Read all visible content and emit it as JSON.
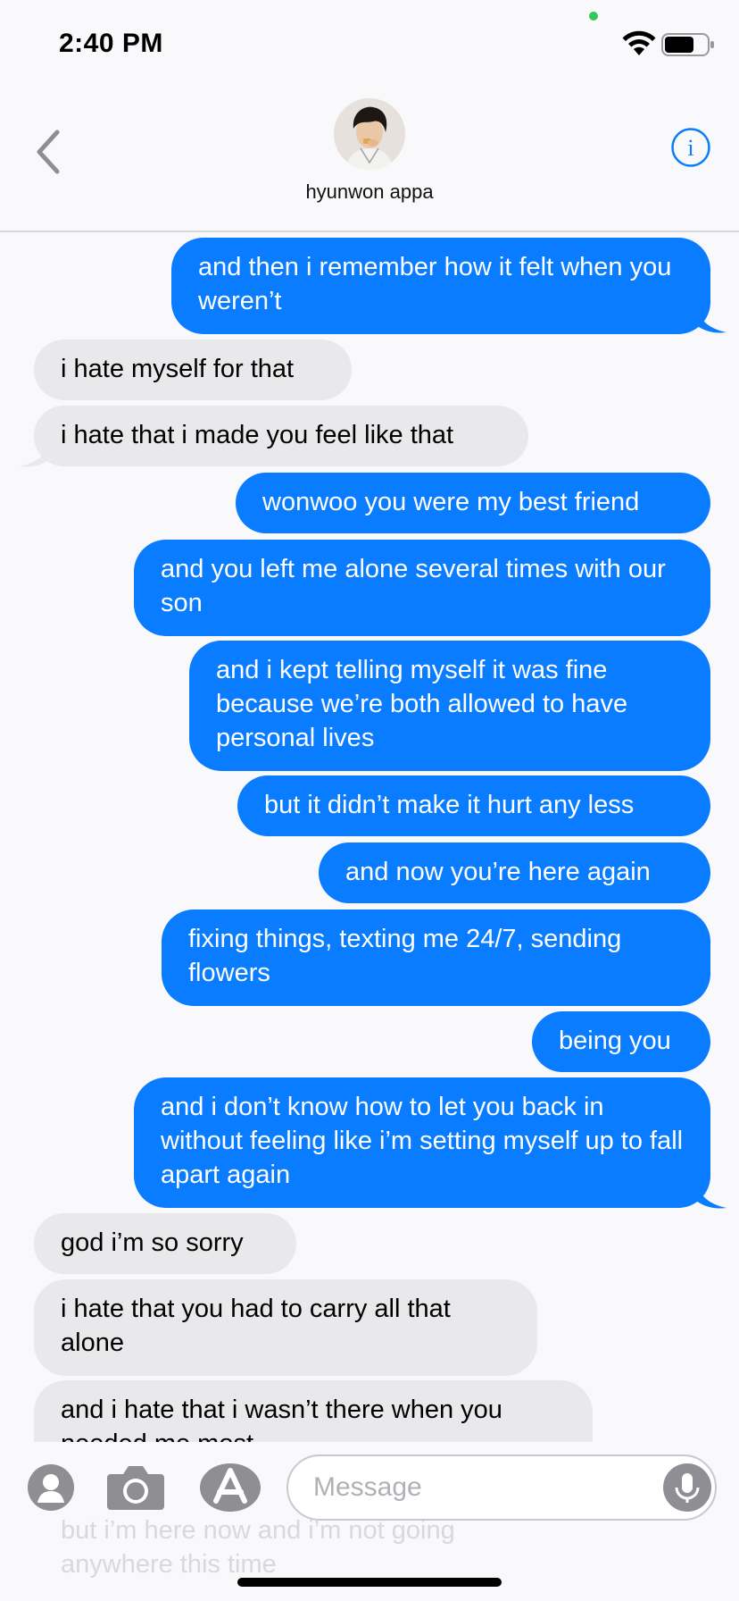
{
  "status_bar": {
    "time": "2:40 PM",
    "icons": [
      "camera-in-use-dot",
      "wifi-icon",
      "battery-icon"
    ]
  },
  "header": {
    "contact_name": "hyunwon appa",
    "back_icon": "chevron-left-icon",
    "info_icon": "info-icon"
  },
  "messages": [
    {
      "direction": "outgoing",
      "text": "and then i remember how it felt when you weren’t"
    },
    {
      "direction": "incoming",
      "text": "i hate myself for that"
    },
    {
      "direction": "incoming",
      "text": "i hate that i made you feel like that"
    },
    {
      "direction": "outgoing",
      "text": "wonwoo you were my best friend"
    },
    {
      "direction": "outgoing",
      "text": "and you left me alone several times with our son"
    },
    {
      "direction": "outgoing",
      "text": "and i kept telling myself it was fine because we’re both allowed to have personal lives"
    },
    {
      "direction": "outgoing",
      "text": "but it didn’t make it hurt any less"
    },
    {
      "direction": "outgoing",
      "text": "and now you’re here again"
    },
    {
      "direction": "outgoing",
      "text": "fixing things, texting me 24/7, sending flowers"
    },
    {
      "direction": "outgoing",
      "text": "being you"
    },
    {
      "direction": "outgoing",
      "text": "and i don’t know how to let you back in without feeling like i’m setting myself up to fall apart again"
    },
    {
      "direction": "incoming",
      "text": "god i’m so sorry"
    },
    {
      "direction": "incoming",
      "text": "i hate that you had to carry all that alone"
    },
    {
      "direction": "incoming",
      "text": "and i hate that i wasn’t there when you needed me most"
    }
  ],
  "ghost_message": "but i’m here now and i’m not going anywhere this time",
  "input_bar": {
    "placeholder": "Message",
    "icons": [
      "contact-card-icon",
      "camera-icon",
      "app-store-icon",
      "microphone-icon"
    ]
  },
  "colors": {
    "outgoing_bubble": "#0A7CFF",
    "incoming_bubble": "#E9E9EB",
    "accent": "#0A7CFF",
    "background": "#F9F9FB"
  }
}
